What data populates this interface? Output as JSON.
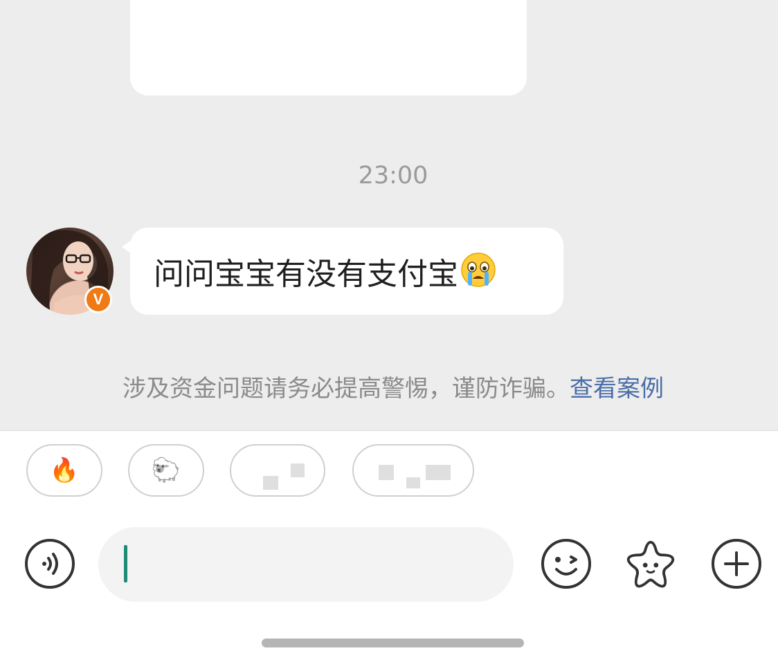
{
  "chat": {
    "timestamp": "23:00",
    "message": {
      "text": "问问宝宝有没有支付宝",
      "emoji": "loudly-crying-face"
    },
    "avatar": {
      "badge": "V",
      "badge_color": "#f07a16"
    },
    "warning": {
      "text": "涉及资金问题请务必提高警惕，谨防诈骗。",
      "link": "查看案例",
      "link_color": "#4a6da7"
    }
  },
  "quick_replies": [
    {
      "icon": "fire-icon",
      "glyph": "🔥"
    },
    {
      "icon": "sheep-icon",
      "glyph": "🐑"
    },
    {
      "icon": "blurred"
    },
    {
      "icon": "blurred"
    }
  ],
  "composer": {
    "input_value": "",
    "caret_color": "#1f8a76",
    "buttons": [
      "voice-icon",
      "emoji-icon",
      "sticker-star-icon",
      "plus-icon"
    ]
  }
}
